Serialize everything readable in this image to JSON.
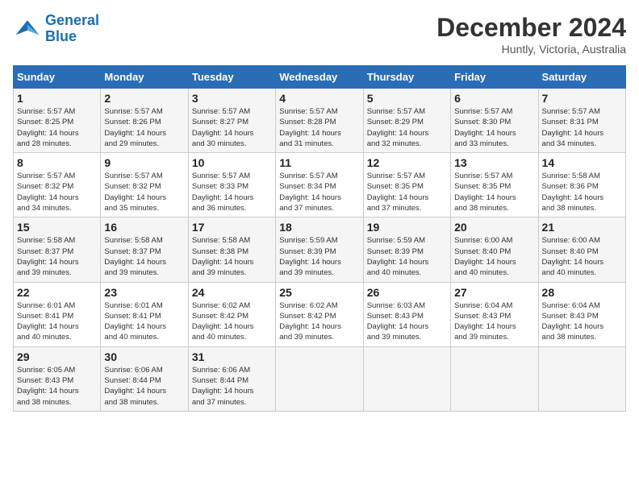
{
  "logo": {
    "line1": "General",
    "line2": "Blue"
  },
  "title": "December 2024",
  "location": "Huntly, Victoria, Australia",
  "days_of_week": [
    "Sunday",
    "Monday",
    "Tuesday",
    "Wednesday",
    "Thursday",
    "Friday",
    "Saturday"
  ],
  "weeks": [
    [
      {
        "day": "1",
        "sunrise": "5:57 AM",
        "sunset": "8:25 PM",
        "daylight": "14 hours and 28 minutes."
      },
      {
        "day": "2",
        "sunrise": "5:57 AM",
        "sunset": "8:26 PM",
        "daylight": "14 hours and 29 minutes."
      },
      {
        "day": "3",
        "sunrise": "5:57 AM",
        "sunset": "8:27 PM",
        "daylight": "14 hours and 30 minutes."
      },
      {
        "day": "4",
        "sunrise": "5:57 AM",
        "sunset": "8:28 PM",
        "daylight": "14 hours and 31 minutes."
      },
      {
        "day": "5",
        "sunrise": "5:57 AM",
        "sunset": "8:29 PM",
        "daylight": "14 hours and 32 minutes."
      },
      {
        "day": "6",
        "sunrise": "5:57 AM",
        "sunset": "8:30 PM",
        "daylight": "14 hours and 33 minutes."
      },
      {
        "day": "7",
        "sunrise": "5:57 AM",
        "sunset": "8:31 PM",
        "daylight": "14 hours and 34 minutes."
      }
    ],
    [
      {
        "day": "8",
        "sunrise": "5:57 AM",
        "sunset": "8:32 PM",
        "daylight": "14 hours and 34 minutes."
      },
      {
        "day": "9",
        "sunrise": "5:57 AM",
        "sunset": "8:32 PM",
        "daylight": "14 hours and 35 minutes."
      },
      {
        "day": "10",
        "sunrise": "5:57 AM",
        "sunset": "8:33 PM",
        "daylight": "14 hours and 36 minutes."
      },
      {
        "day": "11",
        "sunrise": "5:57 AM",
        "sunset": "8:34 PM",
        "daylight": "14 hours and 37 minutes."
      },
      {
        "day": "12",
        "sunrise": "5:57 AM",
        "sunset": "8:35 PM",
        "daylight": "14 hours and 37 minutes."
      },
      {
        "day": "13",
        "sunrise": "5:57 AM",
        "sunset": "8:35 PM",
        "daylight": "14 hours and 38 minutes."
      },
      {
        "day": "14",
        "sunrise": "5:58 AM",
        "sunset": "8:36 PM",
        "daylight": "14 hours and 38 minutes."
      }
    ],
    [
      {
        "day": "15",
        "sunrise": "5:58 AM",
        "sunset": "8:37 PM",
        "daylight": "14 hours and 39 minutes."
      },
      {
        "day": "16",
        "sunrise": "5:58 AM",
        "sunset": "8:37 PM",
        "daylight": "14 hours and 39 minutes."
      },
      {
        "day": "17",
        "sunrise": "5:58 AM",
        "sunset": "8:38 PM",
        "daylight": "14 hours and 39 minutes."
      },
      {
        "day": "18",
        "sunrise": "5:59 AM",
        "sunset": "8:39 PM",
        "daylight": "14 hours and 39 minutes."
      },
      {
        "day": "19",
        "sunrise": "5:59 AM",
        "sunset": "8:39 PM",
        "daylight": "14 hours and 40 minutes."
      },
      {
        "day": "20",
        "sunrise": "6:00 AM",
        "sunset": "8:40 PM",
        "daylight": "14 hours and 40 minutes."
      },
      {
        "day": "21",
        "sunrise": "6:00 AM",
        "sunset": "8:40 PM",
        "daylight": "14 hours and 40 minutes."
      }
    ],
    [
      {
        "day": "22",
        "sunrise": "6:01 AM",
        "sunset": "8:41 PM",
        "daylight": "14 hours and 40 minutes."
      },
      {
        "day": "23",
        "sunrise": "6:01 AM",
        "sunset": "8:41 PM",
        "daylight": "14 hours and 40 minutes."
      },
      {
        "day": "24",
        "sunrise": "6:02 AM",
        "sunset": "8:42 PM",
        "daylight": "14 hours and 40 minutes."
      },
      {
        "day": "25",
        "sunrise": "6:02 AM",
        "sunset": "8:42 PM",
        "daylight": "14 hours and 39 minutes."
      },
      {
        "day": "26",
        "sunrise": "6:03 AM",
        "sunset": "8:43 PM",
        "daylight": "14 hours and 39 minutes."
      },
      {
        "day": "27",
        "sunrise": "6:04 AM",
        "sunset": "8:43 PM",
        "daylight": "14 hours and 39 minutes."
      },
      {
        "day": "28",
        "sunrise": "6:04 AM",
        "sunset": "8:43 PM",
        "daylight": "14 hours and 38 minutes."
      }
    ],
    [
      {
        "day": "29",
        "sunrise": "6:05 AM",
        "sunset": "8:43 PM",
        "daylight": "14 hours and 38 minutes."
      },
      {
        "day": "30",
        "sunrise": "6:06 AM",
        "sunset": "8:44 PM",
        "daylight": "14 hours and 38 minutes."
      },
      {
        "day": "31",
        "sunrise": "6:06 AM",
        "sunset": "8:44 PM",
        "daylight": "14 hours and 37 minutes."
      },
      null,
      null,
      null,
      null
    ]
  ],
  "labels": {
    "sunrise": "Sunrise:",
    "sunset": "Sunset:",
    "daylight": "Daylight:"
  }
}
